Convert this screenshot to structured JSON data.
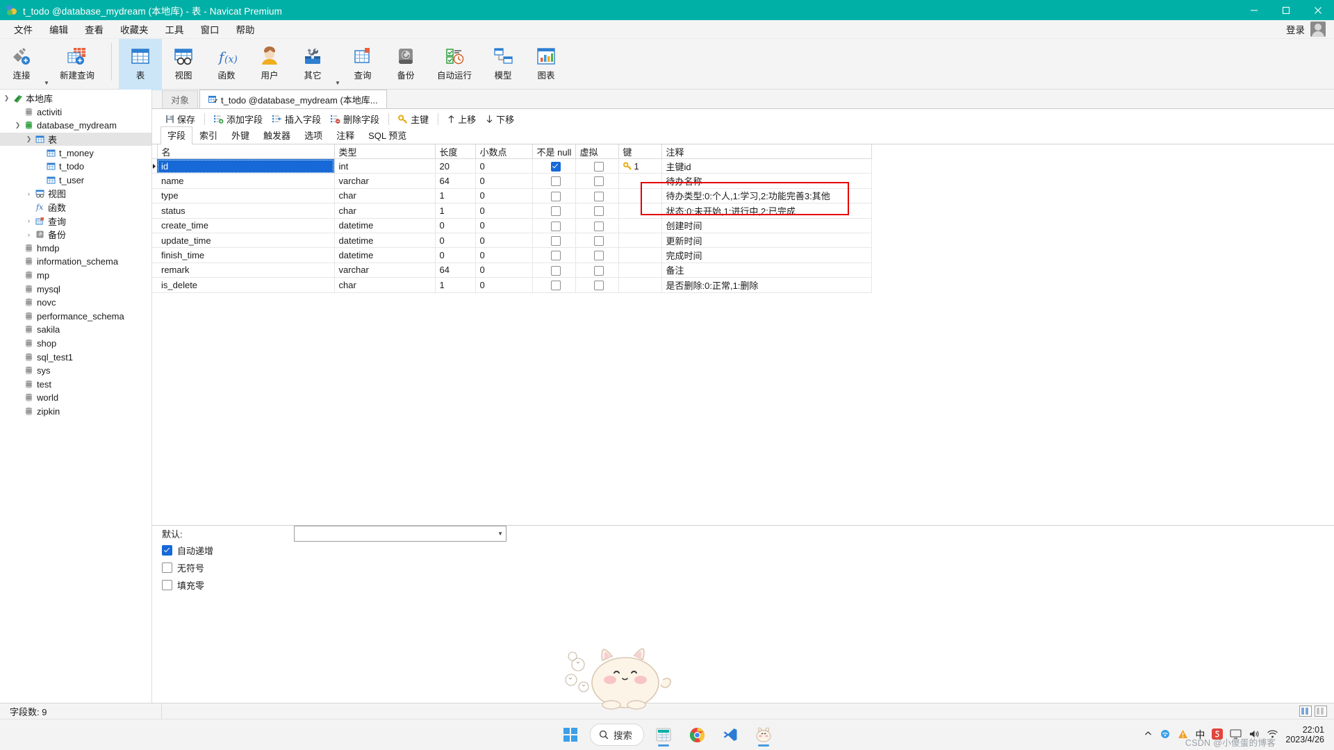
{
  "window": {
    "title": "t_todo @database_mydream (本地库) - 表 - Navicat Premium",
    "minimize": "—",
    "maximize": "□",
    "close": "✕"
  },
  "menubar": {
    "items": [
      "文件",
      "编辑",
      "查看",
      "收藏夹",
      "工具",
      "窗口",
      "帮助"
    ],
    "login": "登录"
  },
  "toolbar": {
    "items": [
      {
        "label": "连接",
        "icon": "connection-icon",
        "caret": true
      },
      {
        "label": "新建查询",
        "icon": "new-query-icon",
        "caret": false
      },
      {
        "label": "表",
        "icon": "table-icon",
        "selected": true
      },
      {
        "label": "视图",
        "icon": "view-icon"
      },
      {
        "label": "函数",
        "icon": "function-icon"
      },
      {
        "label": "用户",
        "icon": "user-icon"
      },
      {
        "label": "其它",
        "icon": "other-tools-icon",
        "caret": true
      },
      {
        "label": "查询",
        "icon": "query-icon"
      },
      {
        "label": "备份",
        "icon": "backup-icon"
      },
      {
        "label": "自动运行",
        "icon": "automation-icon"
      },
      {
        "label": "模型",
        "icon": "model-icon"
      },
      {
        "label": "图表",
        "icon": "chart-icon"
      }
    ]
  },
  "sidebar": {
    "nodes": [
      {
        "label": "本地库",
        "indent": 1,
        "twisty": "down",
        "icon": "connection-green-icon"
      },
      {
        "label": "activiti",
        "indent": 2,
        "twisty": "",
        "icon": "database-icon"
      },
      {
        "label": "database_mydream",
        "indent": 2,
        "twisty": "down",
        "icon": "database-open-icon"
      },
      {
        "label": "表",
        "indent": 3,
        "twisty": "down",
        "icon": "table-folder-icon",
        "selected": true
      },
      {
        "label": "t_money",
        "indent": 4,
        "twisty": "",
        "icon": "table-icon"
      },
      {
        "label": "t_todo",
        "indent": 4,
        "twisty": "",
        "icon": "table-icon"
      },
      {
        "label": "t_user",
        "indent": 4,
        "twisty": "",
        "icon": "table-icon"
      },
      {
        "label": "视图",
        "indent": 3,
        "twisty": "right",
        "icon": "view-folder-icon"
      },
      {
        "label": "函数",
        "indent": 3,
        "twisty": "",
        "icon": "function-folder-icon"
      },
      {
        "label": "查询",
        "indent": 3,
        "twisty": "right",
        "icon": "query-folder-icon"
      },
      {
        "label": "备份",
        "indent": 3,
        "twisty": "right",
        "icon": "backup-folder-icon"
      },
      {
        "label": "hmdp",
        "indent": 2,
        "twisty": "",
        "icon": "database-icon"
      },
      {
        "label": "information_schema",
        "indent": 2,
        "twisty": "",
        "icon": "database-icon"
      },
      {
        "label": "mp",
        "indent": 2,
        "twisty": "",
        "icon": "database-icon"
      },
      {
        "label": "mysql",
        "indent": 2,
        "twisty": "",
        "icon": "database-icon"
      },
      {
        "label": "novc",
        "indent": 2,
        "twisty": "",
        "icon": "database-icon"
      },
      {
        "label": "performance_schema",
        "indent": 2,
        "twisty": "",
        "icon": "database-icon"
      },
      {
        "label": "sakila",
        "indent": 2,
        "twisty": "",
        "icon": "database-icon"
      },
      {
        "label": "shop",
        "indent": 2,
        "twisty": "",
        "icon": "database-icon"
      },
      {
        "label": "sql_test1",
        "indent": 2,
        "twisty": "",
        "icon": "database-icon"
      },
      {
        "label": "sys",
        "indent": 2,
        "twisty": "",
        "icon": "database-icon"
      },
      {
        "label": "test",
        "indent": 2,
        "twisty": "",
        "icon": "database-icon"
      },
      {
        "label": "world",
        "indent": 2,
        "twisty": "",
        "icon": "database-icon"
      },
      {
        "label": "zipkin",
        "indent": 2,
        "twisty": "",
        "icon": "database-icon"
      }
    ]
  },
  "tabs": [
    {
      "label": "对象",
      "active": false
    },
    {
      "label": "t_todo @database_mydream (本地库...",
      "active": true
    }
  ],
  "actions": [
    {
      "label": "保存",
      "icon": "save-icon"
    },
    {
      "label": "添加字段",
      "icon": "add-field-icon"
    },
    {
      "label": "插入字段",
      "icon": "insert-field-icon"
    },
    {
      "label": "删除字段",
      "icon": "delete-field-icon"
    },
    {
      "label": "主键",
      "icon": "primary-key-icon"
    },
    {
      "label": "上移",
      "icon": "move-up-icon"
    },
    {
      "label": "下移",
      "icon": "move-down-icon"
    }
  ],
  "subtabs": [
    {
      "label": "字段",
      "active": true
    },
    {
      "label": "索引",
      "active": false
    },
    {
      "label": "外键",
      "active": false
    },
    {
      "label": "触发器",
      "active": false
    },
    {
      "label": "选项",
      "active": false
    },
    {
      "label": "注释",
      "active": false
    },
    {
      "label": "SQL 预览",
      "active": false
    }
  ],
  "grid": {
    "columns": [
      "名",
      "类型",
      "长度",
      "小数点",
      "不是 null",
      "虚拟",
      "键",
      "注释"
    ],
    "rows": [
      {
        "name": "id",
        "type": "int",
        "length": "20",
        "decimals": "0",
        "notnull": true,
        "virtual": false,
        "key": "1",
        "comment": "主键id",
        "selected": true
      },
      {
        "name": "name",
        "type": "varchar",
        "length": "64",
        "decimals": "0",
        "notnull": false,
        "virtual": false,
        "key": "",
        "comment": "待办名称"
      },
      {
        "name": "type",
        "type": "char",
        "length": "1",
        "decimals": "0",
        "notnull": false,
        "virtual": false,
        "key": "",
        "comment": "待办类型:0:个人,1:学习,2:功能完善3:其他"
      },
      {
        "name": "status",
        "type": "char",
        "length": "1",
        "decimals": "0",
        "notnull": false,
        "virtual": false,
        "key": "",
        "comment": "状态:0:未开始,1:进行中,2:已完成"
      },
      {
        "name": "create_time",
        "type": "datetime",
        "length": "0",
        "decimals": "0",
        "notnull": false,
        "virtual": false,
        "key": "",
        "comment": "创建时间"
      },
      {
        "name": "update_time",
        "type": "datetime",
        "length": "0",
        "decimals": "0",
        "notnull": false,
        "virtual": false,
        "key": "",
        "comment": "更新时间"
      },
      {
        "name": "finish_time",
        "type": "datetime",
        "length": "0",
        "decimals": "0",
        "notnull": false,
        "virtual": false,
        "key": "",
        "comment": "完成时间"
      },
      {
        "name": "remark",
        "type": "varchar",
        "length": "64",
        "decimals": "0",
        "notnull": false,
        "virtual": false,
        "key": "",
        "comment": "备注"
      },
      {
        "name": "is_delete",
        "type": "char",
        "length": "1",
        "decimals": "0",
        "notnull": false,
        "virtual": false,
        "key": "",
        "comment": "是否删除:0:正常,1:删除"
      }
    ],
    "annotation_color": "#e60000"
  },
  "properties": {
    "default_label": "默认:",
    "default_value": "",
    "checkboxes": [
      {
        "label": "自动递增",
        "checked": true
      },
      {
        "label": "无符号",
        "checked": false
      },
      {
        "label": "填充零",
        "checked": false
      }
    ]
  },
  "statusbar": {
    "field_count": "字段数: 9"
  },
  "taskbar": {
    "start": "start-icon",
    "search_placeholder": "搜索",
    "apps": [
      {
        "name": "navicat-icon",
        "active": true
      },
      {
        "name": "chrome-icon",
        "active": false
      },
      {
        "name": "vscode-icon",
        "active": false
      },
      {
        "name": "cat-app-icon",
        "active": true
      }
    ],
    "tray": [
      "chevron-up-icon",
      "network-icon",
      "warning-icon",
      "ime-cn",
      "sogou-icon",
      "monitor-icon",
      "volume-icon",
      "wifi-icon"
    ],
    "ime": "中",
    "clock_time": "22:01",
    "clock_date": "2023/4/26",
    "watermark": "CSDN @小傻蛋的博客"
  }
}
